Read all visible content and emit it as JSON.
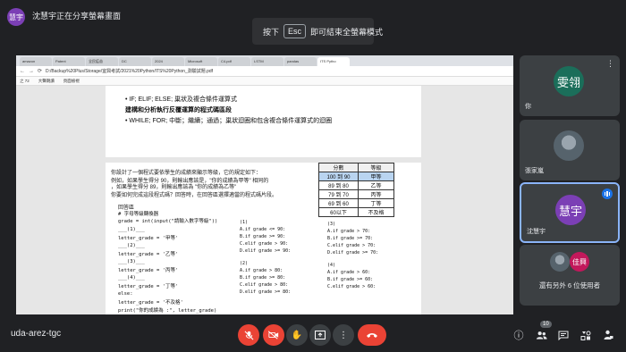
{
  "presenter": {
    "avatar_char": "慧宇",
    "sharing_text": "沈慧宇正在分享螢幕畫面"
  },
  "fullscreen_banner": {
    "prefix": "按下",
    "key": "Esc",
    "suffix": "即可結束全螢幕模式"
  },
  "shared_screen": {
    "browser_tabs": [
      "amazon",
      "Patent",
      "全民疫苗",
      "DC",
      "2024",
      "Microsoft",
      "C4.pdf",
      "LSTM",
      "pandas",
      "ITS Pytho"
    ],
    "url": "D:/Backup%20Plus/Storage/宜興考試/2021%20Python/ITS%20Python_測驗試題.pdf",
    "pdf_toolbar": {
      "page": "之 72",
      "zoom": "大聲朗讀",
      "page_view": "頁面檢視"
    },
    "page_top": {
      "bullet1": "•  IF; ELIF; ELSE; 巢狀及複合條件運算式",
      "bold": "建構和分析執行反覆運算的程式碼區段",
      "bullet2": "•  WHILE; FOR; 中斷；繼續；通過；巢狀迴圈和包含複合條件運算式的迴圈"
    },
    "question": {
      "q1": "你設計了一個程式要依學生的成績來顯示等級，它的規定如下：",
      "q2": "例如，如果學生得分 90，則輸出應該是，\"你的成績為甲等\" 相同的",
      "q3": "，如果學生得分 89，則輸出應該為 \"你的成績為乙等\"",
      "q4": "你要如何完成這段程式碼？回答時，在回答區選擇適當的程式碼片段。"
    },
    "grade_table": {
      "headers": [
        "分數",
        "等級"
      ],
      "rows": [
        [
          "100 到 90",
          "甲等"
        ],
        [
          "89 到 80",
          "乙等"
        ],
        [
          "79 到 70",
          "丙等"
        ],
        [
          "69 到 60",
          "丁等"
        ],
        [
          "60以下",
          "不及格"
        ]
      ]
    },
    "code": {
      "area_title": "回答區",
      "lines": [
        "# 字母等級轉換器",
        "grade = int(input(\"請輸入數字等級\"))",
        "___(1)___",
        "    letter_grade = '甲等'",
        "___(2)___",
        "    letter_grade = '乙等'",
        "___(3)___",
        "    letter_grade = '丙等'",
        "___(4)___",
        "    letter_grade = '丁等'",
        "else:",
        "    letter_grade = '不及格'",
        "print(\"你的成績為 :\", letter_grade)"
      ]
    },
    "options": {
      "g1_label": "(1)",
      "g1": [
        "A.if grade <= 90:",
        "B.if grade >= 90:",
        "C.elif grade > 90:",
        "D.elif grade >= 90:"
      ],
      "g2_label": "(2)",
      "g2": [
        "A.if grade > 80:",
        "B.if grade >= 80:",
        "C.elif grade > 80:",
        "D.elif grade >= 80:"
      ],
      "g3_label": "(3)",
      "g3": [
        "A.if grade > 70:",
        "B.if grade >= 70:",
        "C.elif grade > 70:",
        "D.elif grade >= 70:"
      ],
      "g4_label": "(4)",
      "g4": [
        "A.if grade > 60:",
        "B.if grade >= 60:",
        "C.elif grade > 60:"
      ]
    }
  },
  "participants": [
    {
      "avatar_char": "雯翎",
      "name": "你",
      "color": "#1b6e5a"
    },
    {
      "avatar_char": "",
      "name": "張家嵐",
      "color": ""
    },
    {
      "avatar_char": "慧宇",
      "name": "沈慧宇",
      "color": "#7b3fb5"
    }
  ],
  "more_tile": {
    "avatar_char": "佳興",
    "text": "還有另外 6 位使用者",
    "color": "#c2185b"
  },
  "bottom_bar": {
    "meeting_code": "uda-arez-tgc",
    "people_count": "10"
  }
}
